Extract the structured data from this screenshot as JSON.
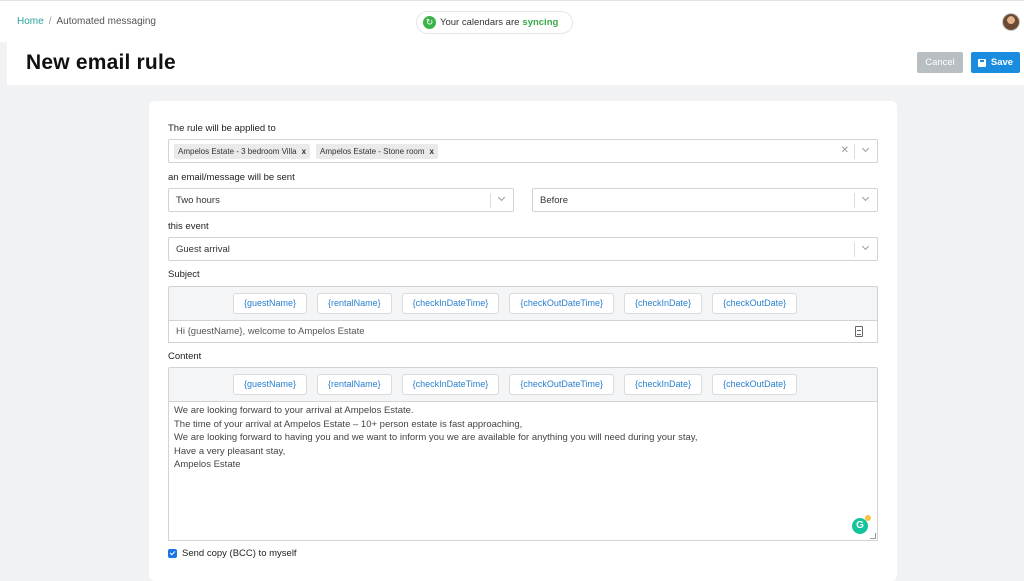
{
  "breadcrumb": {
    "home": "Home",
    "separator": "/",
    "current": "Automated messaging"
  },
  "sync": {
    "text": "Your calendars are",
    "status": "syncing"
  },
  "header": {
    "title": "New email rule",
    "cancel_label": "Cancel",
    "save_label": "Save"
  },
  "form": {
    "applied_label": "The rule will be applied to",
    "rentals": [
      "Ampelos Estate - 3 bedroom Villa",
      "Ampelos Estate - Stone room"
    ],
    "remove_glyph": "x",
    "sent_label": "an email/message will be sent",
    "timing_value": "Two hours",
    "relation_value": "Before",
    "event_label": "this event",
    "event_value": "Guest arrival",
    "subject_label": "Subject",
    "tags": [
      "{guestName}",
      "{rentalName}",
      "{checkInDateTime}",
      "{checkOutDateTime}",
      "{checkInDate}",
      "{checkOutDate}"
    ],
    "subject_value": "Hi {guestName}, welcome to Ampelos Estate",
    "content_label": "Content",
    "content_lines": [
      "We are looking forward to your arrival at Ampelos Estate.",
      "",
      "The time of your arrival at Ampelos Estate – 10+ person estate is fast approaching,",
      "We are looking forward to having you and we want to inform you we are available for anything you will need during your stay,",
      "",
      "Have a very pleasant stay,",
      "Ampelos Estate"
    ],
    "bcc_label": "Send copy (BCC) to myself"
  },
  "colors": {
    "accent": "#1a8ce0",
    "link": "#2a80cf",
    "home_link": "#2ba39b",
    "sync_green": "#3aa84a"
  }
}
